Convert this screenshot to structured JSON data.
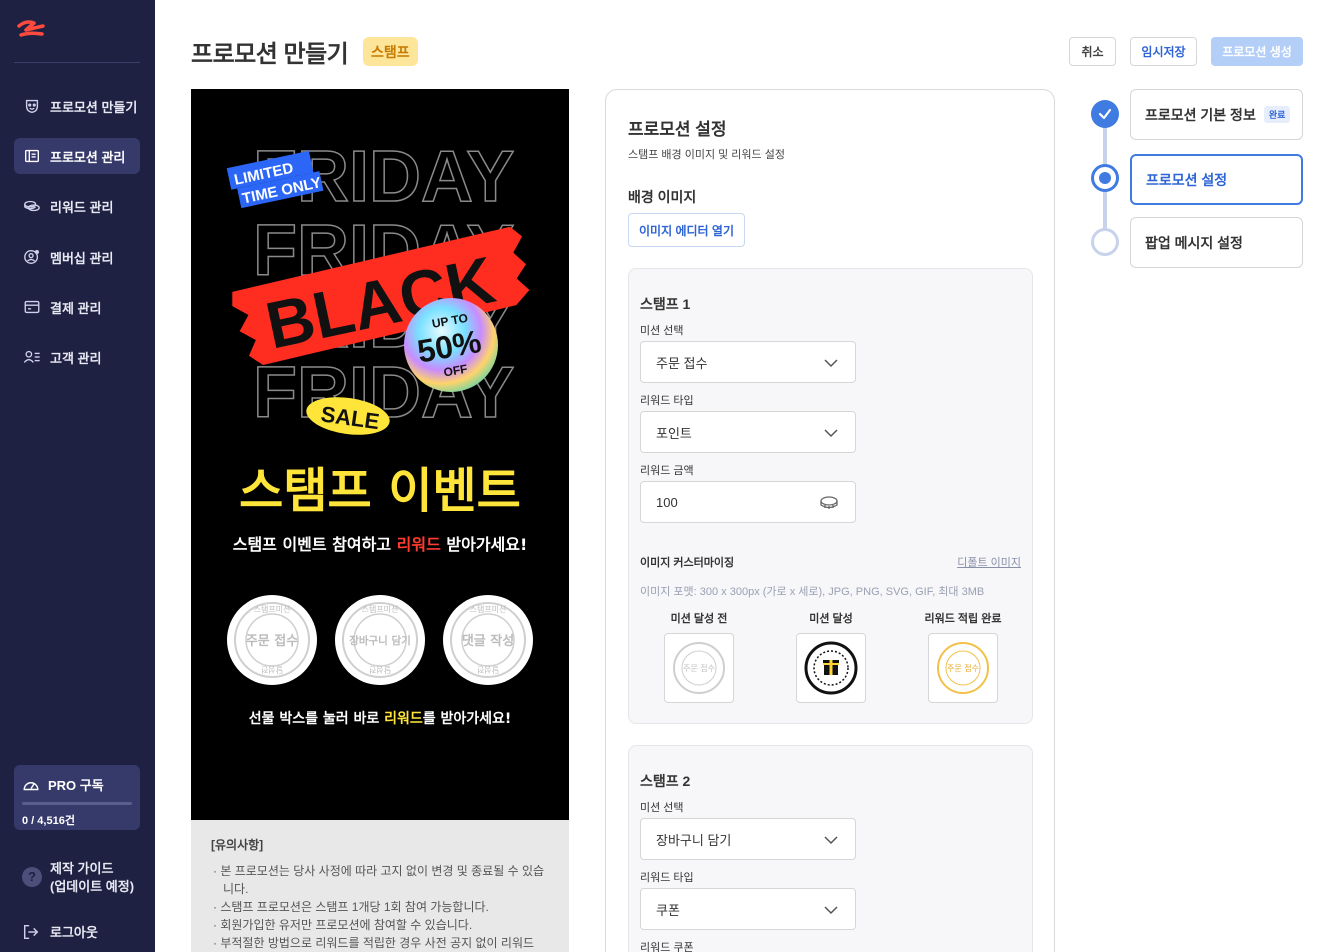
{
  "sidebar": {
    "items": [
      {
        "label": "프로모션 만들기",
        "icon": "theater-mask-icon"
      },
      {
        "label": "프로모션 관리",
        "icon": "layout-icon"
      },
      {
        "label": "리워드 관리",
        "icon": "coins-icon"
      },
      {
        "label": "멤버십 관리",
        "icon": "member-badge-icon"
      },
      {
        "label": "결제 관리",
        "icon": "wallet-icon"
      },
      {
        "label": "고객 관리",
        "icon": "user-list-icon"
      }
    ],
    "active_index": 1,
    "pro": {
      "title": "PRO 구독",
      "count": "0 / 4,516건",
      "progress": 0
    },
    "guide": {
      "line1": "제작 가이드",
      "line2": "(업데이트 예정)"
    },
    "logout": "로그아웃"
  },
  "header": {
    "title": "프로모션 만들기",
    "badge": "스탬프",
    "cancel": "취소",
    "save_draft": "임시저장",
    "create": "프로모션 생성"
  },
  "preview": {
    "bg_word": "FRIDAY",
    "limited1": "LIMITED",
    "limited2": "TIME ONLY",
    "black": "BLACK",
    "upto": "UP TO",
    "percent": "50%",
    "off": "OFF",
    "sale": "SALE",
    "headline": "스탬프 이벤트",
    "sub_before": "스탬프 이벤트 참여하고 ",
    "sub_highlight": "리워드",
    "sub_after": " 받아가세요!",
    "stamps": [
      {
        "ring_top": "스탬프미션",
        "center": "주문 접수",
        "ring_bottom": "달성전"
      },
      {
        "ring_top": "스탬프미션",
        "center": "장바구니 담기",
        "ring_bottom": "달성전"
      },
      {
        "ring_top": "스탬프미션",
        "center": "댓글 작성",
        "ring_bottom": "달성전"
      }
    ],
    "gift_before": "선물 박스를 눌러 바로 ",
    "gift_highlight": "리워드",
    "gift_after": "를 받아가세요!"
  },
  "notice": {
    "title": "[유의사항]",
    "items": [
      "· 본 프로모션는 당사 사정에 따라 고지 없이 변경 및 종료될 수 있습니다.",
      "· 스탬프 프로모션은 스탬프 1개당 1회 참여 가능합니다.",
      "· 회원가입한 유저만 프로모션에 참여할 수 있습니다.",
      "· 부적절한 방법으로 리워드를 적립한 경우 사전 공지 없이 리워드"
    ]
  },
  "panel": {
    "title": "프로모션 설정",
    "subtitle": "스탬프 배경 이미지 및 리워드 설정",
    "bg_label": "배경 이미지",
    "open_editor": "이미지 에디터 열기",
    "stamp1": {
      "title": "스탬프 1",
      "mission_label": "미션 선택",
      "mission_value": "주문 접수",
      "reward_type_label": "리워드 타입",
      "reward_type_value": "포인트",
      "reward_amount_label": "리워드 금액",
      "reward_amount_value": "100",
      "custom_label": "이미지 커스터마이징",
      "default_link": "디폴트 이미지",
      "format_hint": "이미지 포맷: 300 x 300px (가로 x 세로), JPG, PNG, SVG, GIF, 최대 3MB",
      "img_before": "미션 달성 전",
      "img_done": "미션 달성",
      "img_reward": "리워드 적립 완료"
    },
    "stamp2": {
      "title": "스탬프 2",
      "mission_label": "미션 선택",
      "mission_value": "장바구니 담기",
      "reward_type_label": "리워드 타입",
      "reward_type_value": "쿠폰",
      "reward_coupon_label": "리워드 쿠폰"
    }
  },
  "steps": [
    {
      "label": "프로모션 기본 정보",
      "badge": "완료",
      "state": "done"
    },
    {
      "label": "프로모션 설정",
      "state": "current"
    },
    {
      "label": "팝업 메시지 설정",
      "state": "todo"
    }
  ],
  "colors": {
    "sidebar": "#1f2142",
    "accent": "#3f7be0",
    "badge_bg": "#fde59a",
    "red": "#ff3b2f",
    "yellow": "#ffe53a"
  }
}
